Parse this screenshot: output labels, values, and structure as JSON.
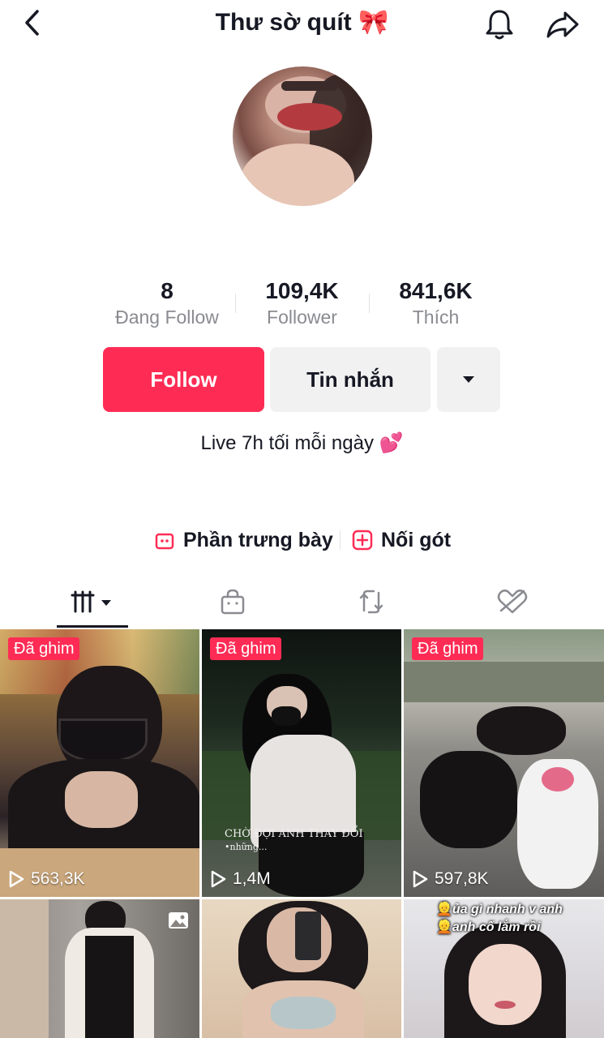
{
  "header": {
    "title": "Thư sờ quít 🎀"
  },
  "stats": [
    {
      "value": "8",
      "label": "Đang Follow"
    },
    {
      "value": "109,4K",
      "label": "Follower"
    },
    {
      "value": "841,6K",
      "label": "Thích"
    }
  ],
  "actions": {
    "follow": "Follow",
    "message": "Tin nhắn"
  },
  "bio": "Live 7h tối mỗi ngày 💕",
  "links": {
    "showcase": "Phần trưng bày",
    "link": "Nối gót"
  },
  "videos": [
    {
      "badge": "Đã ghim",
      "views": "563,3K"
    },
    {
      "badge": "Đã ghim",
      "views": "1,4M",
      "overlay": "CHỜ ĐỢI ANH THAY ĐỔI",
      "overlay2": "•những..."
    },
    {
      "badge": "Đã ghim",
      "views": "597,8K"
    },
    {},
    {},
    {
      "caption1": "ủa gì nhanh v anh",
      "caption2": "anh cố lắm rồi"
    }
  ],
  "colors": {
    "accent": "#fe2c55",
    "text": "#161823",
    "muted": "#8a8b91",
    "button_bg": "#f1f1f2"
  }
}
